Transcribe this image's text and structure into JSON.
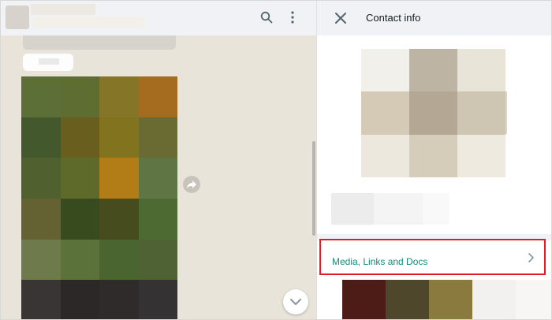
{
  "chat": {
    "chat_grid_colors": [
      "#5c6f36",
      "#5e6e33",
      "#857526",
      "#a56c20",
      "#44582d",
      "#6a5e1e",
      "#82731f",
      "#6a6a33",
      "#51602f",
      "#5d6a2a",
      "#b27d17",
      "#5f7544",
      "#646233",
      "#384b1e",
      "#464c1e",
      "#4e6a33",
      "#6e7a4b",
      "#5b733a",
      "#4b6530",
      "#4f6234",
      "#3a3535",
      "#2c2828",
      "#2f2b2b",
      "#343232"
    ]
  },
  "contact_info": {
    "title": "Contact info",
    "photo_colors": [
      "#f2f0ea",
      "#bdb4a4",
      "#e9e4d8",
      "#d4cab6",
      "#b4a894",
      "#cfc5b3",
      "#ece8dd",
      "#d5ccb9",
      "#eeeae0"
    ],
    "name_colors": [
      "#ececec",
      "#f4f4f4",
      "#f9f9f9"
    ],
    "media_row_label": "Media, Links and Docs",
    "media_thumb_colors": [
      "#4d1c17",
      "#4f472b",
      "#8b7a3d",
      "#f2f1ef",
      "#f7f6f4"
    ]
  },
  "icons": {
    "search": "search-icon",
    "menu": "menu-icon",
    "forward": "forward-icon",
    "scroll_down": "chevron-down-icon",
    "close": "close-icon",
    "chevron_right": "chevron-right-icon"
  }
}
